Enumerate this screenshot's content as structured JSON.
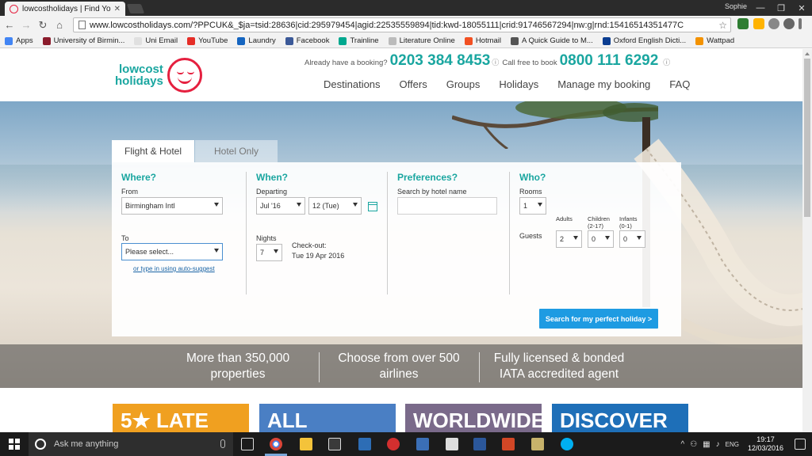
{
  "browser": {
    "tab_title": "lowcostholidays | Find Yo",
    "tab_close": "✕",
    "user": "Sophie",
    "win_min": "—",
    "win_max": "❐",
    "win_close": "✕",
    "url": "www.lowcostholidays.com/?PPCUK&_$ja=tsid:28636|cid:295979454|agid:22535559894|tid:kwd-18055111|crid:91746567294|nw:g|rnd:15416514351477C",
    "back": "←",
    "forward": "→",
    "reload": "↻",
    "home": "⌂",
    "star": "☆",
    "bookmarks": [
      {
        "label": "Apps",
        "color": "#4285f4"
      },
      {
        "label": "University of Birmin...",
        "color": "#8b1c2c"
      },
      {
        "label": "Uni Email",
        "color": "#e0e0e0"
      },
      {
        "label": "YouTube",
        "color": "#e52d27"
      },
      {
        "label": "Laundry",
        "color": "#1565c0"
      },
      {
        "label": "Facebook",
        "color": "#3b5998"
      },
      {
        "label": "Trainline",
        "color": "#00a88f"
      },
      {
        "label": "Literature Online",
        "color": "#bbbbbb"
      },
      {
        "label": "Hotmail",
        "color": "#f25022"
      },
      {
        "label": "A Quick Guide to M...",
        "color": "#555555"
      },
      {
        "label": "Oxford English Dicti...",
        "color": "#0b3d91"
      },
      {
        "label": "Wattpad",
        "color": "#f39200"
      }
    ]
  },
  "header": {
    "logo_line1": "lowcost",
    "logo_line2": "holidays",
    "already_booking": "Already have a booking?",
    "booking_phone": "0203 384 8453",
    "info_icon": "ⓘ",
    "call_free": "Call free to book",
    "free_phone": "0800 111 6292",
    "nav": [
      "Destinations",
      "Offers",
      "Groups",
      "Holidays",
      "Manage my booking",
      "FAQ"
    ]
  },
  "search": {
    "tabs": [
      "Flight & Hotel",
      "Hotel Only"
    ],
    "where": {
      "heading": "Where?",
      "from_label": "From",
      "from_value": "Birmingham Intl",
      "to_label": "To",
      "to_value": "Please select...",
      "autosuggest": "or type in using auto-suggest"
    },
    "when": {
      "heading": "When?",
      "departing_label": "Departing",
      "month": "Jul '16",
      "day": "12 (Tue)",
      "nights_label": "Nights",
      "nights": "7",
      "checkout_label": "Check-out:",
      "checkout_date": "Tue 19 Apr 2016"
    },
    "preferences": {
      "heading": "Preferences?",
      "hotel_label": "Search by hotel name",
      "hotel_value": ""
    },
    "who": {
      "heading": "Who?",
      "rooms_label": "Rooms",
      "rooms": "1",
      "guests_label": "Guests",
      "adults_label": "Adults",
      "children_label": "Children",
      "children_range": "(2-17)",
      "infants_label": "Infants",
      "infants_range": "(0-1)",
      "adults": "2",
      "children": "0",
      "infants": "0"
    },
    "button": "Search for my perfect holiday >"
  },
  "usp": [
    {
      "line1": "More than 350,000",
      "line2": "properties"
    },
    {
      "line1": "Choose from over 500",
      "line2": "airlines"
    },
    {
      "line1": "Fully licensed & bonded",
      "line2": "IATA accredited agent"
    }
  ],
  "promos": [
    {
      "label": "5★ LATE",
      "color": "#f0a020"
    },
    {
      "label": "ALL",
      "color": "#4a7fc4"
    },
    {
      "label": "WORLDWIDE",
      "color": "#7a6a8a"
    },
    {
      "label": "DISCOVER",
      "color": "#1e6fb8"
    }
  ],
  "taskbar": {
    "search_placeholder": "Ask me anything",
    "time": "19:17",
    "date": "12/03/2016",
    "tray_up": "^",
    "tray_icons": [
      "⚇",
      "▦",
      "♪",
      "ENG"
    ]
  },
  "colors": {
    "brand_teal": "#1aa6a0",
    "brand_red": "#e5203f",
    "cta_blue": "#1e9be2"
  }
}
